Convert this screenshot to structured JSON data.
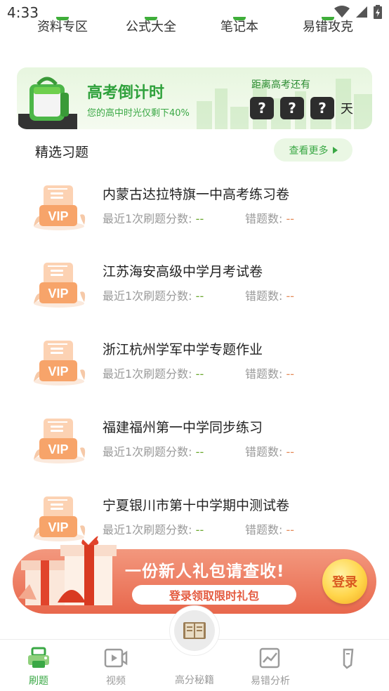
{
  "status_bar": {
    "time": "4:33"
  },
  "quick_nav": {
    "items": [
      {
        "label": "资料专区"
      },
      {
        "label": "公式大全"
      },
      {
        "label": "笔记本"
      },
      {
        "label": "易错攻克"
      }
    ]
  },
  "countdown": {
    "title": "高考倒计时",
    "subtitle": "您的高中时光仅剩下40%",
    "label": "距离高考还有",
    "digits": [
      "?",
      "?",
      "?"
    ],
    "unit": "天"
  },
  "featured": {
    "title": "精选习题",
    "more_label": "查看更多"
  },
  "exercises": [
    {
      "title": "内蒙古达拉特旗一中高考练习卷",
      "score_label": "最近1次刷题分数:",
      "score_value": "--",
      "errors_label": "错题数:",
      "errors_value": "--"
    },
    {
      "title": "江苏海安高级中学月考试卷",
      "score_label": "最近1次刷题分数:",
      "score_value": "--",
      "errors_label": "错题数:",
      "errors_value": "--"
    },
    {
      "title": "浙江杭州学军中学专题作业",
      "score_label": "最近1次刷题分数:",
      "score_value": "--",
      "errors_label": "错题数:",
      "errors_value": "--"
    },
    {
      "title": "福建福州第一中学同步练习",
      "score_label": "最近1次刷题分数:",
      "score_value": "--",
      "errors_label": "错题数:",
      "errors_value": "--"
    },
    {
      "title": "宁夏银川市第十中学期中测试卷",
      "score_label": "最近1次刷题分数:",
      "score_value": "--",
      "errors_label": "错题数:",
      "errors_value": "--"
    }
  ],
  "vip_badge": "VIP",
  "promo": {
    "title": "一份新人礼包请查收!",
    "subtitle": "登录领取限时礼包",
    "login_label": "登录"
  },
  "tabbar": {
    "tabs": [
      {
        "label": "刷题",
        "active": true
      },
      {
        "label": "视频",
        "active": false
      },
      {
        "label": "高分秘籍",
        "active": false
      },
      {
        "label": "易错分析",
        "active": false
      },
      {
        "label": "",
        "active": false
      }
    ]
  },
  "colors": {
    "accent": "#3aa845",
    "promo": "#e8674c",
    "score": "#6aa82c",
    "errors": "#e58b5a"
  }
}
